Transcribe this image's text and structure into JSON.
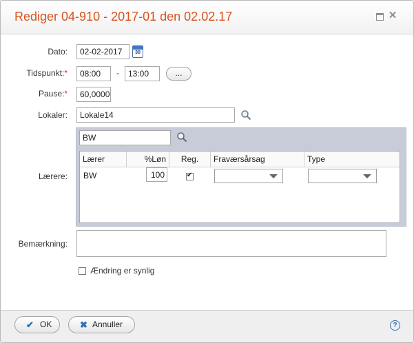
{
  "dialog": {
    "title": "Rediger 04-910 - 2017-01 den 02.02.17"
  },
  "form": {
    "date_label": "Dato:",
    "date_value": "02-02-2017",
    "calendar_day": "30",
    "time_label": "Tidspunkt:",
    "required_mark": "*",
    "time_from": "08:00",
    "time_separator": "-",
    "time_to": "13:00",
    "time_more_label": "...",
    "pause_label": "Pause:",
    "pause_value": "60,00000",
    "rooms_label": "Lokaler:",
    "rooms_value": "Lokale14",
    "teachers_label": "Lærere:",
    "remark_label": "Bemærkning:",
    "remark_value": "",
    "visible_change_label": "Ændring er synlig",
    "visible_change_checked": false
  },
  "teachers": {
    "filter_value": "BW",
    "columns": [
      "Lærer",
      "%Løn",
      "Reg.",
      "Fraværsårsag",
      "Type"
    ],
    "rows": [
      {
        "teacher": "BW",
        "salary_pct": "100",
        "registered": true,
        "absence_reason": "",
        "type": ""
      }
    ]
  },
  "footer": {
    "ok_label": "OK",
    "cancel_label": "Annuller",
    "help_label": "?"
  },
  "colors": {
    "title": "#d9531e",
    "required": "#d32f2f",
    "panel": "#c8cbd8",
    "ok_check": "#2d6fb4",
    "cancel_x": "#2d6fb4"
  },
  "icons": {
    "calendar": "calendar-icon",
    "rooms_search": "search-icon",
    "teacher_search": "search-icon",
    "maximize": "maximize-icon",
    "close": "close-icon",
    "help": "help-icon"
  }
}
